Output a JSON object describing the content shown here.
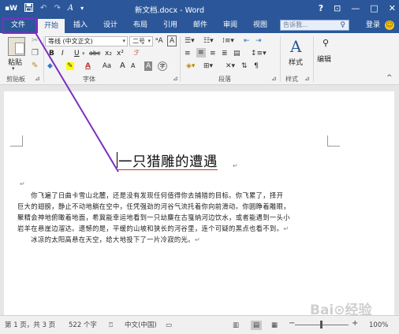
{
  "titlebar": {
    "qat": {
      "word_icon": "W",
      "save_icon": "save-icon",
      "undo": "↶",
      "redo": "↷",
      "style_btn": "A",
      "customize": "▾"
    },
    "title": "新文档.docx - Word",
    "help": "?",
    "ribbon_options": "⊡",
    "minimize": "—",
    "maximize": "□",
    "close": "✕"
  },
  "tabs": [
    {
      "label": "文件"
    },
    {
      "label": "开始"
    },
    {
      "label": "插入"
    },
    {
      "label": "设计"
    },
    {
      "label": "布局"
    },
    {
      "label": "引用"
    },
    {
      "label": "邮件"
    },
    {
      "label": "审阅"
    },
    {
      "label": "视图"
    }
  ],
  "tellme": {
    "placeholder": "告诉我..."
  },
  "account": {
    "login": "登录"
  },
  "ribbon": {
    "clipboard": {
      "paste": "粘贴",
      "label": "剪贴板"
    },
    "font": {
      "name": "等线 (中文正文)",
      "size": "二号",
      "row2": [
        "B",
        "I",
        "U",
        "abc",
        "x₂",
        "x²"
      ],
      "row3": [
        "A",
        "Aa",
        "A",
        "A"
      ],
      "label": "字体"
    },
    "paragraph": {
      "label": "段落"
    },
    "styles": {
      "button": "样式",
      "label": "样式"
    },
    "editing": {
      "button": "编辑"
    }
  },
  "document": {
    "heading": "一只猎雕的遭遇",
    "para_mark": "↵",
    "lines": [
      "　　你飞遍了日曲卡雪山北麓，还是没有发现任何值得你去捕猎的目标。你飞累了，择开",
      "巨大的翅膀，静止不动地躺在空中，任凭强劲的河谷气流托着你向前滑动。你圆睁着雕眼，",
      "聚精会神地俯瞰着地面，希冀能幸运地看到一只幼麋在古戛纳河边饮水，或者能遇到一头小",
      "岩羊在悬崖边溜达。遗憾的是，平缓的山坡和狭长的河谷里，连个可疑的黑点也看不到。",
      "　　冰凉的太阳高悬在天空，给大地投下了一片冷寂的光。"
    ],
    "watermark": "Bai⊙经验"
  },
  "statusbar": {
    "page": "第 1 页，共 3 页",
    "words": "522 个字",
    "lang": "中文(中国)",
    "zoom_out": "−",
    "zoom_in": "+",
    "zoom": "100%"
  }
}
